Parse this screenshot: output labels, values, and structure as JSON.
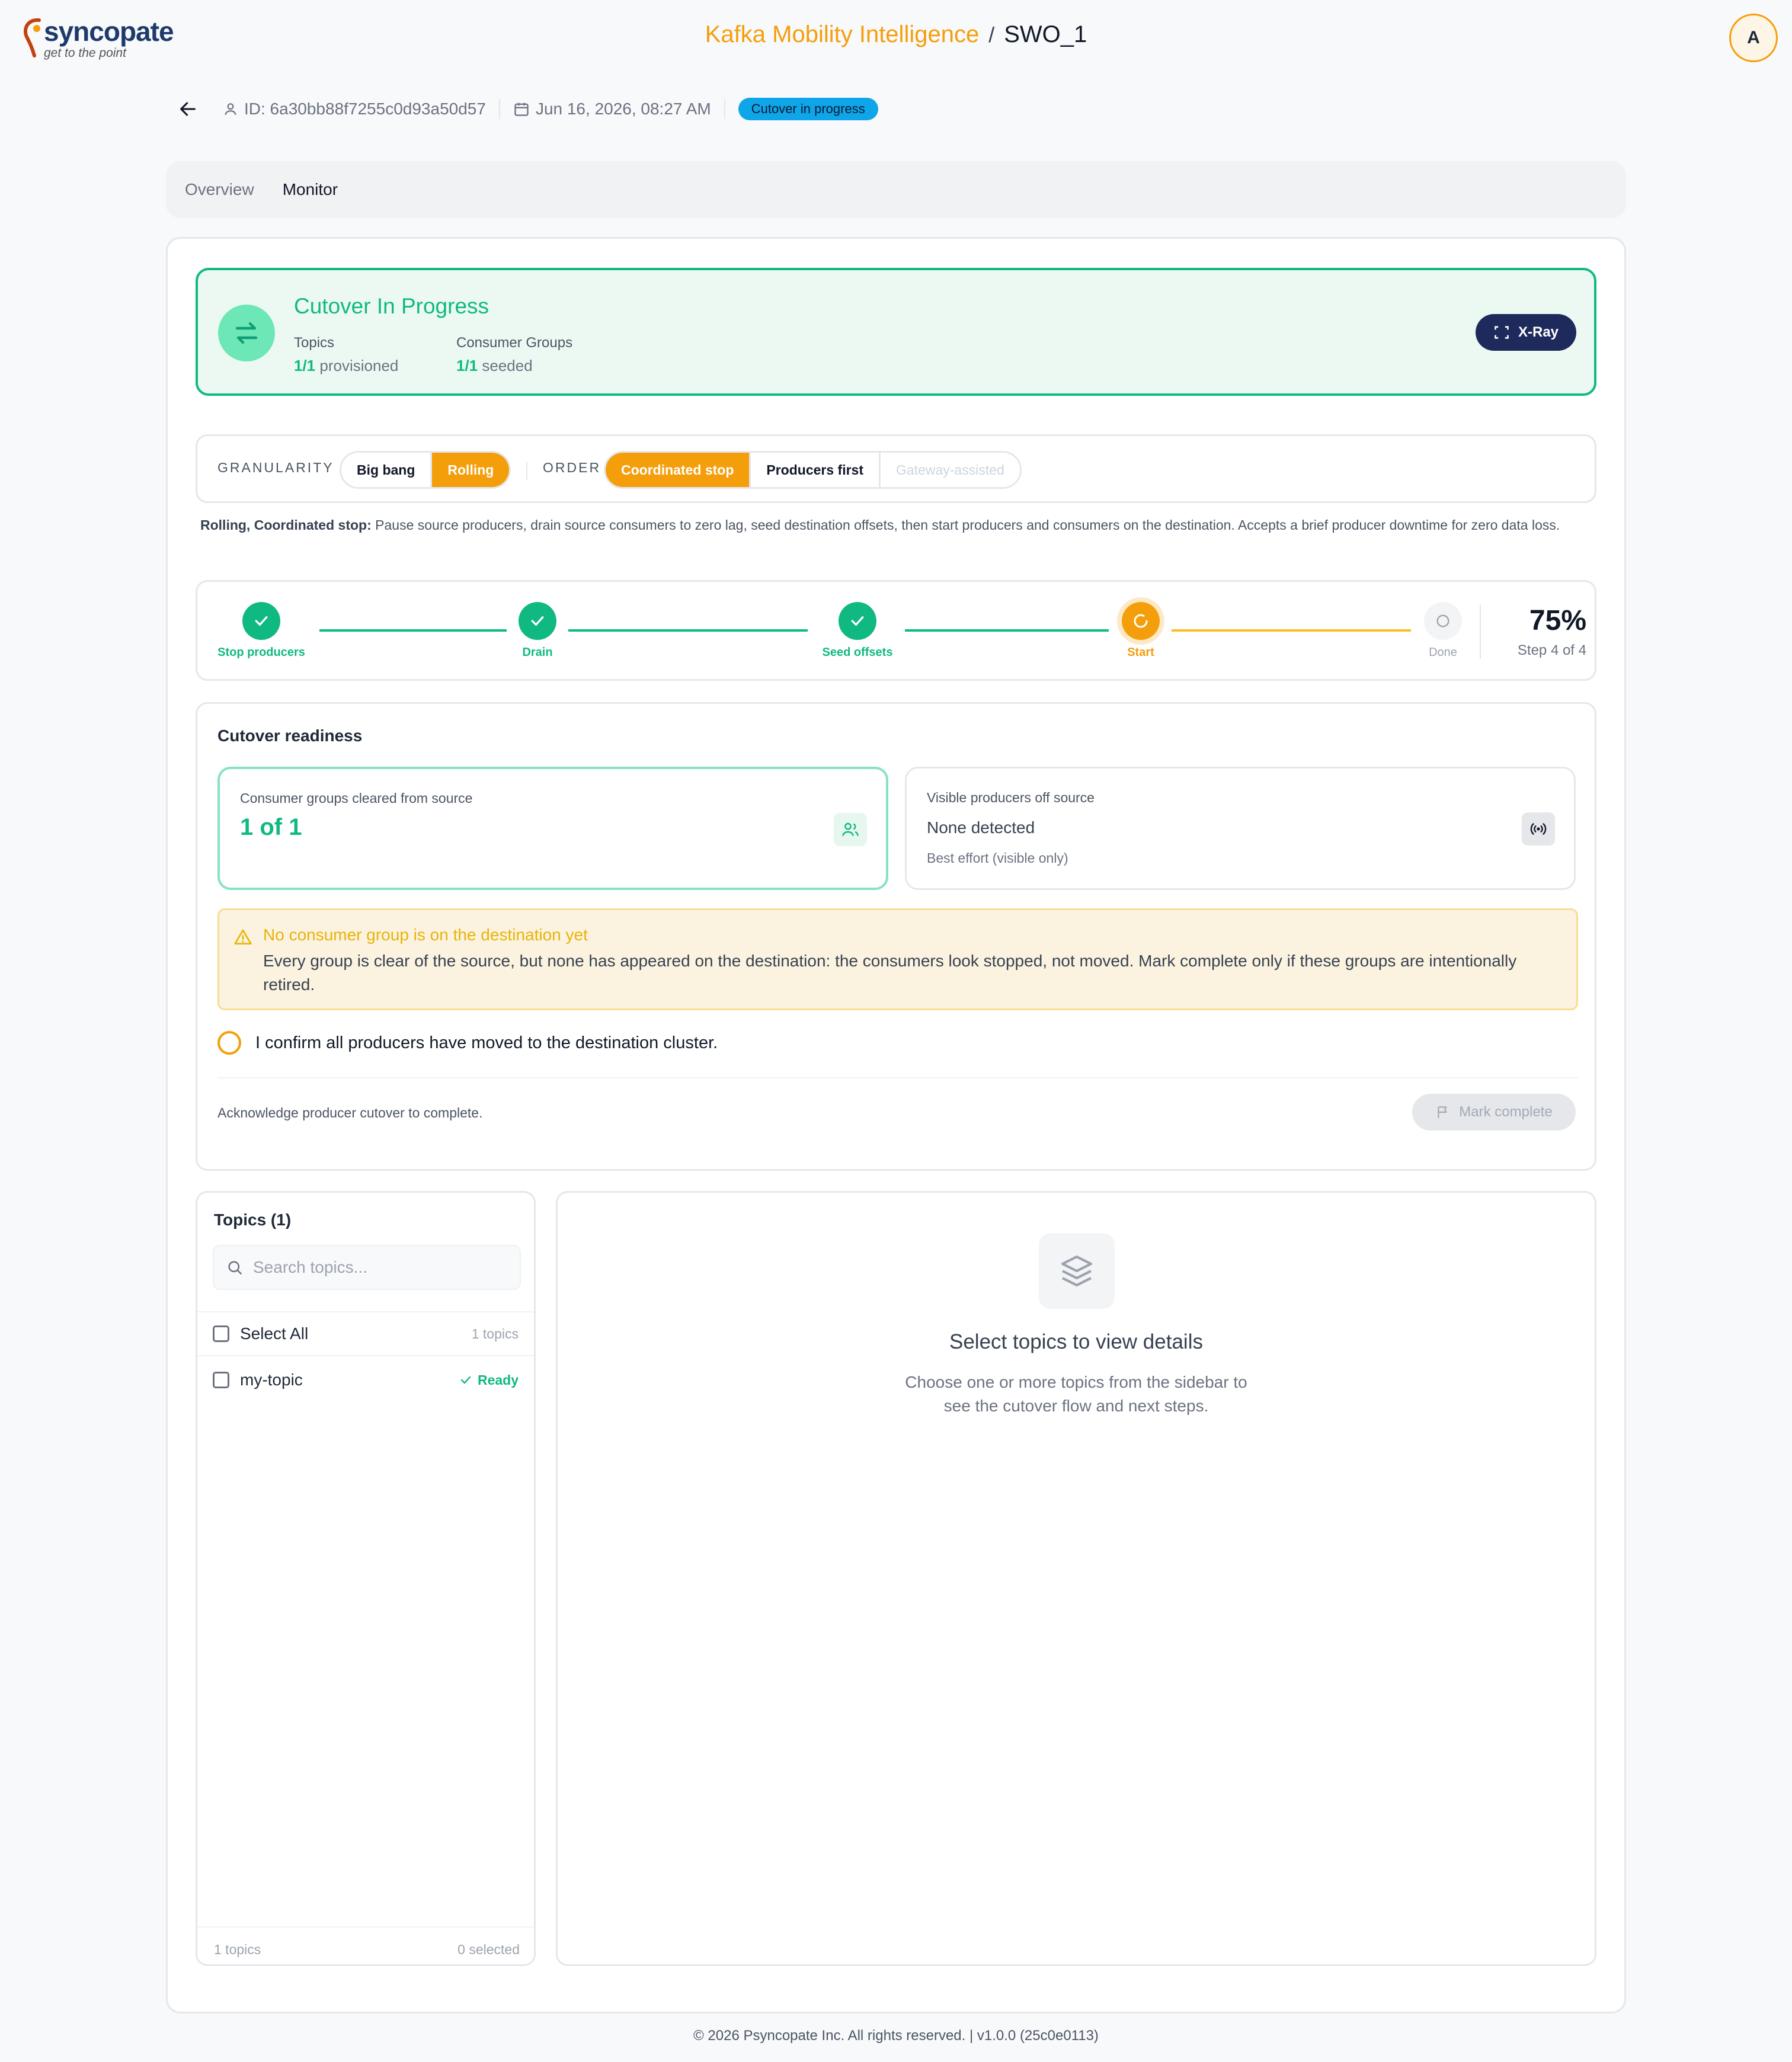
{
  "brand": {
    "name": "syncopate",
    "tagline": "get to the point"
  },
  "header": {
    "app_name": "Kafka Mobility Intelligence",
    "separator": "/",
    "current": "SWO_1",
    "avatar_initial": "A"
  },
  "meta": {
    "id_text": "ID: 6a30bb88f7255c0d93a50d57",
    "date_text": "Jun 16, 2026, 08:27 AM",
    "status_badge": "Cutover in progress"
  },
  "tabs": [
    {
      "label": "Overview",
      "active": false
    },
    {
      "label": "Monitor",
      "active": true
    }
  ],
  "summary": {
    "title": "Cutover In Progress",
    "topics_label": "Topics",
    "topics_value": "1/1",
    "topics_suffix": "provisioned",
    "cg_label": "Consumer Groups",
    "cg_value": "1/1",
    "cg_suffix": "seeded",
    "xray_label": "X-Ray"
  },
  "strategy": {
    "granularity_label": "GRANULARITY",
    "granularity_options": [
      {
        "label": "Big bang",
        "selected": false
      },
      {
        "label": "Rolling",
        "selected": true
      }
    ],
    "order_label": "ORDER",
    "order_options": [
      {
        "label": "Coordinated stop",
        "selected": true
      },
      {
        "label": "Producers first",
        "selected": false
      },
      {
        "label": "Gateway-assisted",
        "selected": false,
        "disabled": true
      }
    ],
    "desc_bold": "Rolling, Coordinated stop:",
    "desc_text": "Pause source producers, drain source consumers to zero lag, seed destination offsets, then start producers and consumers on the destination. Accepts a brief producer downtime for zero data loss."
  },
  "stepper": {
    "steps": [
      {
        "label": "Stop producers",
        "state": "done"
      },
      {
        "label": "Drain",
        "state": "done"
      },
      {
        "label": "Seed offsets",
        "state": "done"
      },
      {
        "label": "Start",
        "state": "current"
      },
      {
        "label": "Done",
        "state": "pending"
      }
    ],
    "percent_text": "75%",
    "percent": 75,
    "step_text": "Step 4 of 4"
  },
  "readiness": {
    "title": "Cutover readiness",
    "cg_card_label": "Consumer groups cleared from source",
    "cg_card_value": "1 of 1",
    "prod_card_label": "Visible producers off source",
    "prod_card_value": "None detected",
    "prod_card_sub": "Best effort (visible only)",
    "warning_title": "No consumer group is on the destination yet",
    "warning_body": "Every group is clear of the source, but none has appeared on the destination: the consumers look stopped, not moved. Mark complete only if these groups are intentionally retired.",
    "confirm_text": "I confirm all producers have moved to the destination cluster.",
    "ack_text": "Acknowledge producer cutover to complete.",
    "mark_complete_label": "Mark complete"
  },
  "topics": {
    "title": "Topics (1)",
    "search_placeholder": "Search topics...",
    "select_all_label": "Select All",
    "select_all_count": "1 topics",
    "items": [
      {
        "name": "my-topic",
        "status": "Ready"
      }
    ],
    "footer_count": "1 topics",
    "footer_selected": "0 selected"
  },
  "details": {
    "empty_title": "Select topics to view details",
    "empty_body": "Choose one or more topics from the sidebar to see the cutover flow and next steps."
  },
  "footer": {
    "text": "© 2026 Psyncopate Inc. All rights reserved. | v1.0.0 (25c0e0113)"
  },
  "colors": {
    "accent": "#f59e0b",
    "success": "#10b981",
    "navy": "#1e2a5c",
    "badge": "#0ea5e9"
  }
}
